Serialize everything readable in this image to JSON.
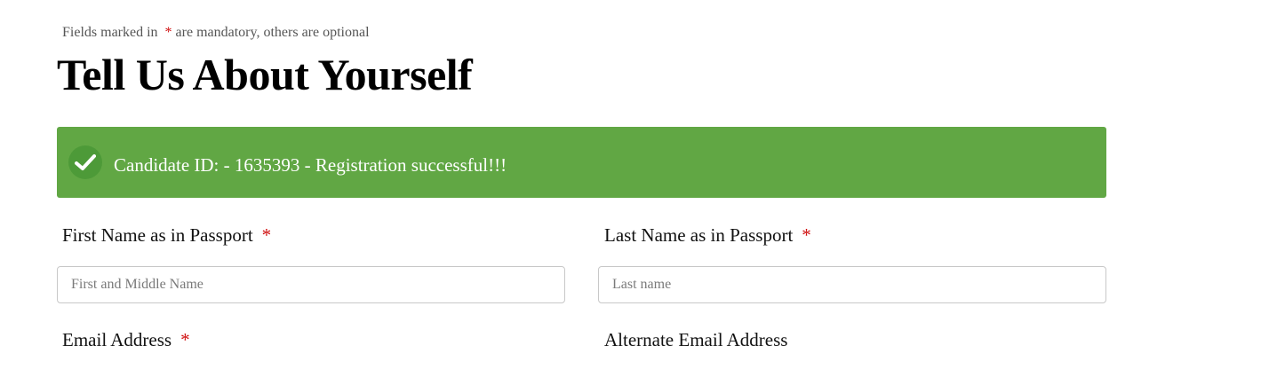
{
  "form": {
    "hint_prefix": "Fields marked in",
    "hint_star": "*",
    "hint_suffix": "are mandatory, others are optional",
    "title": "Tell Us About Yourself",
    "alert": {
      "icon": "check-circle-icon",
      "message": "Candidate ID: - 1635393 - Registration successful!!!",
      "color": "#61a744"
    },
    "fields": {
      "first_name": {
        "label": "First Name as in Passport",
        "required_mark": "*",
        "placeholder": "First and Middle Name",
        "value": ""
      },
      "last_name": {
        "label": "Last Name as in Passport",
        "required_mark": "*",
        "placeholder": "Last name",
        "value": ""
      },
      "email": {
        "label": "Email Address",
        "required_mark": "*"
      },
      "alt_email": {
        "label": "Alternate Email Address"
      }
    },
    "required_color": "#d01010"
  }
}
